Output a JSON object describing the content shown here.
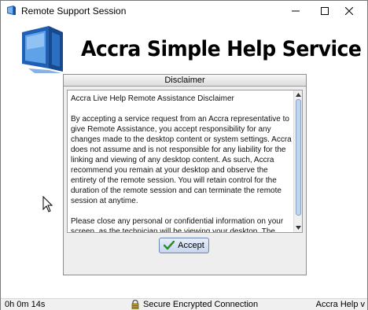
{
  "window": {
    "title": "Remote Support Session",
    "controls": {
      "minimize": "minimize",
      "maximize": "maximize",
      "close": "close"
    }
  },
  "header": {
    "brand": "Accra Simple Help Service",
    "logo_icon": "monitor-logo-icon"
  },
  "dialog": {
    "title": "Disclaimer",
    "paragraphs": [
      "Accra Live Help Remote Assistance Disclaimer",
      "By accepting a service request from an Accra representative to give Remote Assistance, you accept responsibility for any changes made to the desktop content or system settings. Accra does not assume and is not responsible for any liability for the linking and viewing of any desktop content. As such, Accra recommend you remain at your desktop and observe the entirety of the remote session. You will retain control for the duration of the remote session and can terminate the remote session at anytime.",
      "Please close any personal or confidential information on your screen, as the technician will be viewing your desktop. The client"
    ],
    "accept_label": "Accept"
  },
  "status": {
    "timer": "0h 0m 14s",
    "secure": "Secure Encrypted Connection",
    "version": "Accra Help v"
  },
  "colors": {
    "accept_button": "#c8d6ee",
    "scroll_thumb": "#c2d4ea",
    "brand_text": "#000000"
  }
}
